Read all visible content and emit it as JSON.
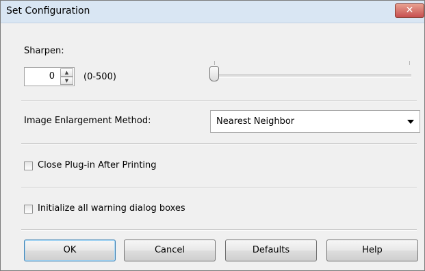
{
  "window": {
    "title": "Set Configuration",
    "close_glyph": "✕"
  },
  "sharpen": {
    "label": "Sharpen:",
    "value": "0",
    "range_label": "(0-500)",
    "min": 0,
    "max": 500,
    "slider_fraction": 0
  },
  "enlargement": {
    "label": "Image Enlargement Method:",
    "selected": "Nearest Neighbor"
  },
  "options": {
    "close_plugin_label": "Close Plug-in After Printing",
    "close_plugin_checked": false,
    "init_warnings_label": "Initialize all warning dialog boxes",
    "init_warnings_checked": false
  },
  "buttons": {
    "ok": "OK",
    "cancel": "Cancel",
    "defaults": "Defaults",
    "help": "Help"
  },
  "icons": {
    "spin_up": "up-arrow-icon",
    "spin_down": "down-arrow-icon",
    "combo": "chevron-down-icon",
    "close": "close-icon"
  },
  "colors": {
    "close_button": "#c75050",
    "titlebar": "#d9e6f3",
    "dialog_bg": "#f0f0f0"
  }
}
